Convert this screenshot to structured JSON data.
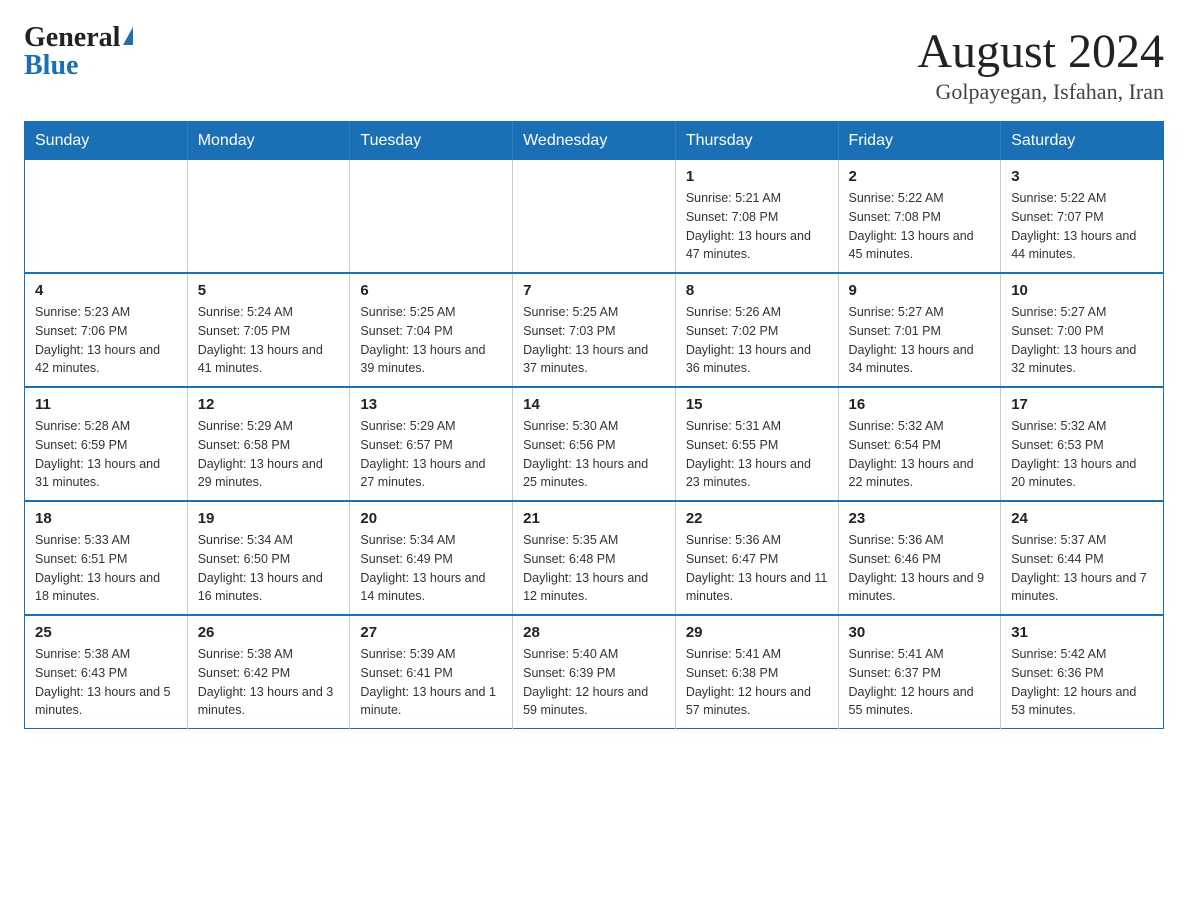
{
  "logo": {
    "general": "General",
    "blue": "Blue"
  },
  "title": {
    "month": "August 2024",
    "location": "Golpayegan, Isfahan, Iran"
  },
  "days_of_week": [
    "Sunday",
    "Monday",
    "Tuesday",
    "Wednesday",
    "Thursday",
    "Friday",
    "Saturday"
  ],
  "weeks": [
    [
      {
        "day": "",
        "sunrise": "",
        "sunset": "",
        "daylight": ""
      },
      {
        "day": "",
        "sunrise": "",
        "sunset": "",
        "daylight": ""
      },
      {
        "day": "",
        "sunrise": "",
        "sunset": "",
        "daylight": ""
      },
      {
        "day": "",
        "sunrise": "",
        "sunset": "",
        "daylight": ""
      },
      {
        "day": "1",
        "sunrise": "Sunrise: 5:21 AM",
        "sunset": "Sunset: 7:08 PM",
        "daylight": "Daylight: 13 hours and 47 minutes."
      },
      {
        "day": "2",
        "sunrise": "Sunrise: 5:22 AM",
        "sunset": "Sunset: 7:08 PM",
        "daylight": "Daylight: 13 hours and 45 minutes."
      },
      {
        "day": "3",
        "sunrise": "Sunrise: 5:22 AM",
        "sunset": "Sunset: 7:07 PM",
        "daylight": "Daylight: 13 hours and 44 minutes."
      }
    ],
    [
      {
        "day": "4",
        "sunrise": "Sunrise: 5:23 AM",
        "sunset": "Sunset: 7:06 PM",
        "daylight": "Daylight: 13 hours and 42 minutes."
      },
      {
        "day": "5",
        "sunrise": "Sunrise: 5:24 AM",
        "sunset": "Sunset: 7:05 PM",
        "daylight": "Daylight: 13 hours and 41 minutes."
      },
      {
        "day": "6",
        "sunrise": "Sunrise: 5:25 AM",
        "sunset": "Sunset: 7:04 PM",
        "daylight": "Daylight: 13 hours and 39 minutes."
      },
      {
        "day": "7",
        "sunrise": "Sunrise: 5:25 AM",
        "sunset": "Sunset: 7:03 PM",
        "daylight": "Daylight: 13 hours and 37 minutes."
      },
      {
        "day": "8",
        "sunrise": "Sunrise: 5:26 AM",
        "sunset": "Sunset: 7:02 PM",
        "daylight": "Daylight: 13 hours and 36 minutes."
      },
      {
        "day": "9",
        "sunrise": "Sunrise: 5:27 AM",
        "sunset": "Sunset: 7:01 PM",
        "daylight": "Daylight: 13 hours and 34 minutes."
      },
      {
        "day": "10",
        "sunrise": "Sunrise: 5:27 AM",
        "sunset": "Sunset: 7:00 PM",
        "daylight": "Daylight: 13 hours and 32 minutes."
      }
    ],
    [
      {
        "day": "11",
        "sunrise": "Sunrise: 5:28 AM",
        "sunset": "Sunset: 6:59 PM",
        "daylight": "Daylight: 13 hours and 31 minutes."
      },
      {
        "day": "12",
        "sunrise": "Sunrise: 5:29 AM",
        "sunset": "Sunset: 6:58 PM",
        "daylight": "Daylight: 13 hours and 29 minutes."
      },
      {
        "day": "13",
        "sunrise": "Sunrise: 5:29 AM",
        "sunset": "Sunset: 6:57 PM",
        "daylight": "Daylight: 13 hours and 27 minutes."
      },
      {
        "day": "14",
        "sunrise": "Sunrise: 5:30 AM",
        "sunset": "Sunset: 6:56 PM",
        "daylight": "Daylight: 13 hours and 25 minutes."
      },
      {
        "day": "15",
        "sunrise": "Sunrise: 5:31 AM",
        "sunset": "Sunset: 6:55 PM",
        "daylight": "Daylight: 13 hours and 23 minutes."
      },
      {
        "day": "16",
        "sunrise": "Sunrise: 5:32 AM",
        "sunset": "Sunset: 6:54 PM",
        "daylight": "Daylight: 13 hours and 22 minutes."
      },
      {
        "day": "17",
        "sunrise": "Sunrise: 5:32 AM",
        "sunset": "Sunset: 6:53 PM",
        "daylight": "Daylight: 13 hours and 20 minutes."
      }
    ],
    [
      {
        "day": "18",
        "sunrise": "Sunrise: 5:33 AM",
        "sunset": "Sunset: 6:51 PM",
        "daylight": "Daylight: 13 hours and 18 minutes."
      },
      {
        "day": "19",
        "sunrise": "Sunrise: 5:34 AM",
        "sunset": "Sunset: 6:50 PM",
        "daylight": "Daylight: 13 hours and 16 minutes."
      },
      {
        "day": "20",
        "sunrise": "Sunrise: 5:34 AM",
        "sunset": "Sunset: 6:49 PM",
        "daylight": "Daylight: 13 hours and 14 minutes."
      },
      {
        "day": "21",
        "sunrise": "Sunrise: 5:35 AM",
        "sunset": "Sunset: 6:48 PM",
        "daylight": "Daylight: 13 hours and 12 minutes."
      },
      {
        "day": "22",
        "sunrise": "Sunrise: 5:36 AM",
        "sunset": "Sunset: 6:47 PM",
        "daylight": "Daylight: 13 hours and 11 minutes."
      },
      {
        "day": "23",
        "sunrise": "Sunrise: 5:36 AM",
        "sunset": "Sunset: 6:46 PM",
        "daylight": "Daylight: 13 hours and 9 minutes."
      },
      {
        "day": "24",
        "sunrise": "Sunrise: 5:37 AM",
        "sunset": "Sunset: 6:44 PM",
        "daylight": "Daylight: 13 hours and 7 minutes."
      }
    ],
    [
      {
        "day": "25",
        "sunrise": "Sunrise: 5:38 AM",
        "sunset": "Sunset: 6:43 PM",
        "daylight": "Daylight: 13 hours and 5 minutes."
      },
      {
        "day": "26",
        "sunrise": "Sunrise: 5:38 AM",
        "sunset": "Sunset: 6:42 PM",
        "daylight": "Daylight: 13 hours and 3 minutes."
      },
      {
        "day": "27",
        "sunrise": "Sunrise: 5:39 AM",
        "sunset": "Sunset: 6:41 PM",
        "daylight": "Daylight: 13 hours and 1 minute."
      },
      {
        "day": "28",
        "sunrise": "Sunrise: 5:40 AM",
        "sunset": "Sunset: 6:39 PM",
        "daylight": "Daylight: 12 hours and 59 minutes."
      },
      {
        "day": "29",
        "sunrise": "Sunrise: 5:41 AM",
        "sunset": "Sunset: 6:38 PM",
        "daylight": "Daylight: 12 hours and 57 minutes."
      },
      {
        "day": "30",
        "sunrise": "Sunrise: 5:41 AM",
        "sunset": "Sunset: 6:37 PM",
        "daylight": "Daylight: 12 hours and 55 minutes."
      },
      {
        "day": "31",
        "sunrise": "Sunrise: 5:42 AM",
        "sunset": "Sunset: 6:36 PM",
        "daylight": "Daylight: 12 hours and 53 minutes."
      }
    ]
  ]
}
